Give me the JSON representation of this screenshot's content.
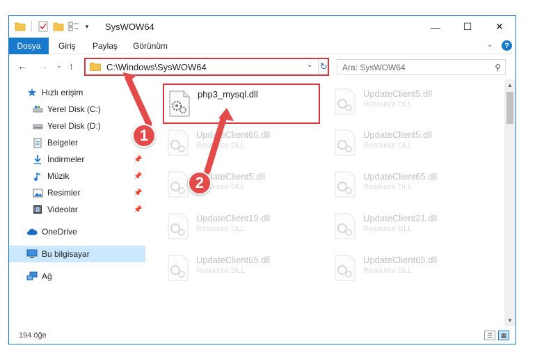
{
  "window": {
    "title": "SysWOW64",
    "minimize_glyph": "—",
    "maximize_glyph": "☐",
    "close_glyph": "✕"
  },
  "ribbon": {
    "tabs": [
      "Dosya",
      "Giriş",
      "Paylaş",
      "Görünüm"
    ],
    "help_glyph": "?"
  },
  "address": {
    "path": "C:\\Windows\\SysWOW64"
  },
  "search": {
    "placeholder": "Ara: SysWOW64"
  },
  "sidebar": {
    "items": [
      {
        "label": "Hızlı erişim",
        "icon": "star-icon"
      },
      {
        "label": "Yerel Disk (C:)",
        "icon": "drive-icon"
      },
      {
        "label": "Yerel Disk (D:)",
        "icon": "drive-icon"
      },
      {
        "label": "Belgeler",
        "icon": "documents-icon"
      },
      {
        "label": "İndirmeler",
        "icon": "download-icon"
      },
      {
        "label": "Müzik",
        "icon": "music-icon"
      },
      {
        "label": "Resimler",
        "icon": "pictures-icon"
      },
      {
        "label": "Videolar",
        "icon": "videos-icon"
      },
      {
        "label": "OneDrive",
        "icon": "cloud-icon"
      },
      {
        "label": "Bu bilgisayar",
        "icon": "computer-icon"
      },
      {
        "label": "Ağ",
        "icon": "network-icon"
      }
    ]
  },
  "files": [
    {
      "name": "php3_mysql.dll",
      "type": ""
    },
    {
      "name": "UpdateClient5.dll",
      "type": "Resource DLL"
    },
    {
      "name": "UpdateClient65.dll",
      "type": "Resource DLL"
    },
    {
      "name": "UpdateClient5.dll",
      "type": "Resource DLL"
    },
    {
      "name": "UpdateClient5.dll",
      "type": "Resource DLL"
    },
    {
      "name": "UpdateClient65.dll",
      "type": "Resource DLL"
    },
    {
      "name": "UpdateClient19.dll",
      "type": "Resource DLL"
    },
    {
      "name": "UpdateClient21.dll",
      "type": "Resource DLL"
    },
    {
      "name": "UpdateClient65.dll",
      "type": "Resource DLL"
    },
    {
      "name": "UpdateClient65.dll",
      "type": "Resource DLL"
    }
  ],
  "status": {
    "count": "194 öğe"
  },
  "annotations": {
    "step1": "1",
    "step2": "2",
    "color": "#e34a4a"
  }
}
